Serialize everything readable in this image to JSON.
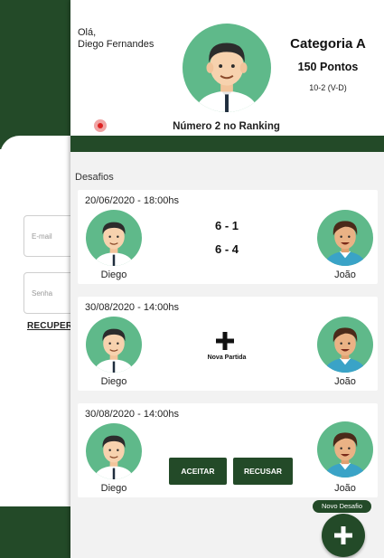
{
  "login_background": {
    "email_placeholder": "E-mail",
    "password_placeholder": "Senha",
    "recover_link": "RECUPER"
  },
  "header": {
    "greeting": "Olá,",
    "user_name": "Diego Fernandes",
    "category": "Categoria A",
    "points": "150 Pontos",
    "record": "10-2 (V-D)",
    "ranking": "Número 2 no Ranking"
  },
  "challenges": {
    "title": "Desafios",
    "items": [
      {
        "date": "20/06/2020 - 18:00hs",
        "player_left": "Diego",
        "player_right": "João",
        "scores": [
          "6 - 1",
          "6 - 4"
        ]
      },
      {
        "date": "30/08/2020 - 14:00hs",
        "player_left": "Diego",
        "player_right": "João",
        "new_match_label": "Nova Partida"
      },
      {
        "date": "30/08/2020 - 14:00hs",
        "player_left": "Diego",
        "player_right": "João",
        "accept_label": "ACEITAR",
        "reject_label": "RECUSAR"
      }
    ]
  },
  "fab": {
    "label": "Novo Desafio",
    "icon": "plus-icon"
  },
  "colors": {
    "primary": "#234a28",
    "avatar_bg": "#5fb98a",
    "avatar_bg_alt": "#3fae9c",
    "panel_bg": "#f2f2f2"
  }
}
